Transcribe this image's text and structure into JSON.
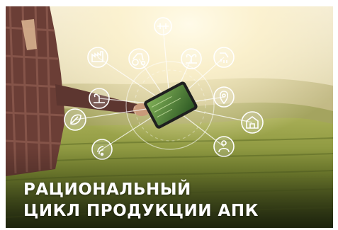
{
  "banner": {
    "title_line1": "РАЦИОНАЛЬНЫЙ",
    "title_line2": "ЦИКЛ ПРОДУКЦИИ АПК"
  },
  "icons": [
    "factory-icon",
    "tractor-icon",
    "plant-sprout-icon",
    "irrigation-icon",
    "hand-plant-icon",
    "location-pin-icon",
    "leaf-circle-icon",
    "warehouse-icon",
    "wifi-signal-icon",
    "farmer-icon",
    "drone-icon"
  ],
  "colors": {
    "sky": "#f4ead0",
    "field": "#8e9a3c",
    "field_dark": "#4d5a22",
    "text": "#ffffff",
    "hud": "#ffffff"
  }
}
